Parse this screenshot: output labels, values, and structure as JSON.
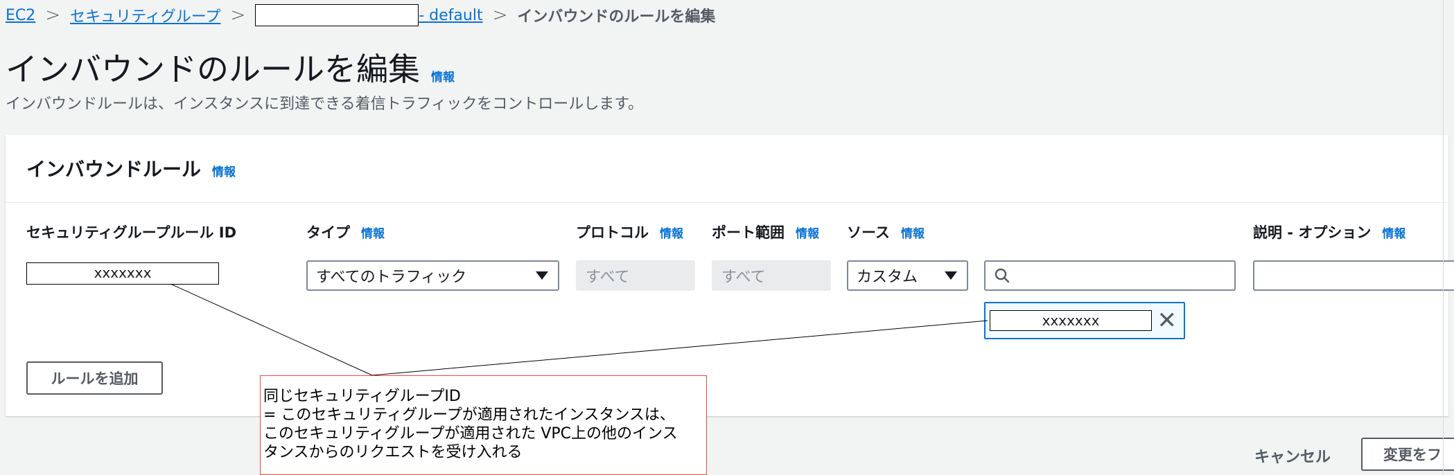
{
  "breadcrumb": {
    "item1": "EC2",
    "item2": "セキュリティグループ",
    "item3_suffix": "- default",
    "current": "インバウンドのルールを編集",
    "separator": ">"
  },
  "page": {
    "title": "インバウンドのルールを編集",
    "info": "情報",
    "subtitle": "インバウンドルールは、インスタンスに到達できる着信トラフィックをコントロールします。"
  },
  "panel": {
    "title": "インバウンドルール",
    "info": "情報",
    "columns": {
      "rule_id": "セキュリティグループルール ID",
      "type": "タイプ",
      "protocol": "プロトコル",
      "port_range": "ポート範囲",
      "source": "ソース",
      "description": "説明 - オプション",
      "info": "情報"
    },
    "row": {
      "rule_id": "xxxxxxx",
      "type": "すべてのトラフィック",
      "protocol": "すべて",
      "port_range": "すべて",
      "source_type": "カスタム",
      "source_search": "",
      "source_token": "xxxxxxx",
      "token_remove": "✕",
      "description": ""
    },
    "add_rule": "ルールを追加"
  },
  "callout": {
    "line1": "同じセキュリティグループID",
    "line2": "= このセキュリティグループが適用されたインスタンスは、",
    "line3": "このセキュリティグループが適用された VPC上の他のインス",
    "line4": "タンスからのリクエストを受け入れる"
  },
  "footer": {
    "cancel": "キャンセル",
    "save": "変更をフ"
  },
  "colors": {
    "link": "#0972d3",
    "callout_border": "#e74c3c",
    "background": "#f2f3f3"
  }
}
